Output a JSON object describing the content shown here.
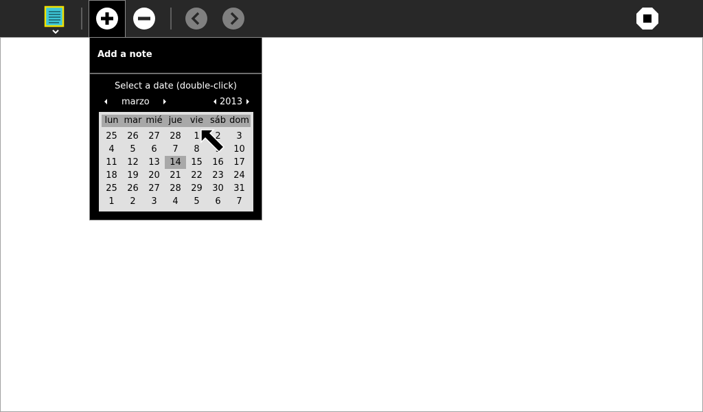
{
  "toolbar": {
    "activity_icon": "notes-activity-icon",
    "add_icon": "add-icon",
    "remove_icon": "remove-icon",
    "back_icon": "back-icon",
    "forward_icon": "forward-icon",
    "stop_icon": "stop-icon"
  },
  "palette": {
    "title": "Add a note",
    "caption": "Select a date (double-click)",
    "month": "marzo",
    "year": "2013"
  },
  "calendar": {
    "weekdays": [
      "lun",
      "mar",
      "mié",
      "jue",
      "vie",
      "sáb",
      "dom"
    ],
    "weeks": [
      [
        "25",
        "26",
        "27",
        "28",
        "1",
        "2",
        "3"
      ],
      [
        "4",
        "5",
        "6",
        "7",
        "8",
        "9",
        "10"
      ],
      [
        "11",
        "12",
        "13",
        "14",
        "15",
        "16",
        "17"
      ],
      [
        "18",
        "19",
        "20",
        "21",
        "22",
        "23",
        "24"
      ],
      [
        "25",
        "26",
        "27",
        "28",
        "29",
        "30",
        "31"
      ],
      [
        "1",
        "2",
        "3",
        "4",
        "5",
        "6",
        "7"
      ]
    ],
    "selected": "14"
  },
  "colors": {
    "toolbar_bg": "#282828",
    "palette_bg": "#000000",
    "calendar_bg": "#e0e0e0",
    "selected_bg": "#a8a8a8",
    "note_fill": "#3dc7d8",
    "note_border": "#f0e000"
  }
}
